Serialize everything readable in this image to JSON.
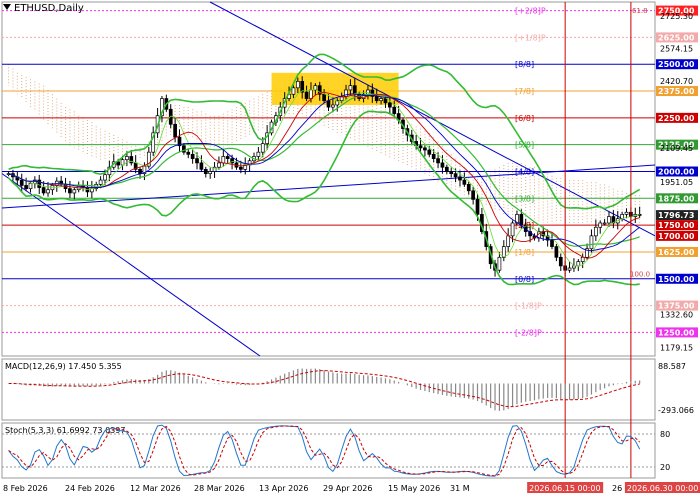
{
  "chart_data": {
    "type": "candlestick",
    "symbol_title": "ETHUSD,Daily",
    "price_axis_ticks": [
      "2725.30",
      "2574.15",
      "2420.70",
      "2109.45",
      "1951.05",
      "1332.60",
      "1179.15"
    ],
    "murrey_levels": [
      {
        "price": 2750.0,
        "label": "[+2/8]P",
        "color": "#ee33ee",
        "box": "2750.00",
        "box_color": "#ff2222"
      },
      {
        "price": 2625.0,
        "label": "[+1/8]P",
        "color": "#f2aaaa",
        "box": "2625.00",
        "box_color": "#f2aaaa"
      },
      {
        "price": 2500.0,
        "label": "[8/8]",
        "color": "#0000cc",
        "box": "2500.00",
        "box_color": "#0000cc"
      },
      {
        "price": 2375.0,
        "label": "[7/8]",
        "color": "#f0a030",
        "box": "2375.00",
        "box_color": "#f0a030"
      },
      {
        "price": 2250.0,
        "label": "[6/8]",
        "color": "#cc0000",
        "box": "2250.00",
        "box_color": "#cc0000"
      },
      {
        "price": 2125.0,
        "label": "[5/8]",
        "color": "#33aa33",
        "box": "2125.00",
        "box_color": "#339933"
      },
      {
        "price": 2000.0,
        "label": "[4/8]",
        "color": "#0000cc",
        "box": "2000.00",
        "box_color": "#0000cc"
      },
      {
        "price": 1875.0,
        "label": "[3/8]",
        "color": "#33aa33",
        "box": "1875.00",
        "box_color": "#339933"
      },
      {
        "price": 1750.0,
        "label": "[2/8]",
        "color": "#cc0000",
        "box": "1750.00",
        "box_color": "#cc0000"
      },
      {
        "price": 1625.0,
        "label": "[1/8]",
        "color": "#f0a030",
        "box": "1625.00",
        "box_color": "#f0a030"
      },
      {
        "price": 1500.0,
        "label": "[0/8]",
        "color": "#0000cc",
        "box": "1500.00",
        "box_color": "#0000cc"
      },
      {
        "price": 1375.0,
        "label": "[-1/8]P",
        "color": "#f2aaaa",
        "box": "1375.00",
        "box_color": "#f2aaaa"
      },
      {
        "price": 1250.0,
        "label": "[-2/8]P",
        "color": "#ee33ee",
        "box": "1250.00",
        "box_color": "#ee33ee"
      }
    ],
    "extra_price_labels": [
      {
        "price": 1796.73,
        "box": "1796.73",
        "box_color": "#222222"
      },
      {
        "price": 1700.0,
        "box": "1700.00",
        "box_color": "#cc0000"
      }
    ],
    "fibo_labels": [
      "61.8",
      "100.0"
    ],
    "x_ticks": [
      "8 Feb 2026",
      "24 Feb 2026",
      "12 Mar 2026",
      "28 Mar 2026",
      "13 Apr 2026",
      "29 Apr 2026",
      "15 May 2026",
      "31 M"
    ],
    "vline_labels": [
      "2026.06.15 00:00",
      "2026.06.30 00:00"
    ],
    "x_tick_tail": "26",
    "price_range": [
      1140,
      2790
    ],
    "days": 145,
    "start_date": "2026-02-08",
    "vlines_dates": [
      "2026-06-15",
      "2026-06-30"
    ],
    "closes": [
      1990,
      1975,
      1960,
      1935,
      1920,
      1945,
      1960,
      1925,
      1900,
      1915,
      1935,
      1955,
      1940,
      1920,
      1900,
      1915,
      1935,
      1925,
      1905,
      1920,
      1940,
      1960,
      1985,
      2020,
      2045,
      2030,
      2055,
      2070,
      2040,
      2010,
      1990,
      2025,
      2090,
      2180,
      2260,
      2340,
      2290,
      2220,
      2160,
      2120,
      2090,
      2080,
      2060,
      2040,
      2010,
      1990,
      2000,
      2020,
      2040,
      2070,
      2060,
      2040,
      2020,
      2010,
      2030,
      2050,
      2070,
      2090,
      2130,
      2180,
      2230,
      2260,
      2300,
      2340,
      2360,
      2390,
      2420,
      2370,
      2340,
      2380,
      2400,
      2360,
      2330,
      2300,
      2310,
      2330,
      2350,
      2380,
      2400,
      2360,
      2340,
      2360,
      2380,
      2350,
      2330,
      2340,
      2320,
      2300,
      2270,
      2240,
      2200,
      2170,
      2140,
      2120,
      2110,
      2100,
      2080,
      2060,
      2040,
      2020,
      2000,
      1990,
      1975,
      1960,
      1940,
      1910,
      1870,
      1800,
      1720,
      1650,
      1570,
      1540,
      1600,
      1650,
      1700,
      1760,
      1800,
      1750,
      1720,
      1700,
      1690,
      1720,
      1700,
      1680,
      1650,
      1600,
      1560,
      1540,
      1550,
      1560,
      1580,
      1600,
      1640,
      1700,
      1740,
      1760,
      1760,
      1790,
      1760,
      1780,
      1800,
      1810,
      1790,
      1800,
      1796
    ],
    "cloud_top": [
      2500,
      2480,
      2460,
      2450,
      2440,
      2430,
      2420,
      2410,
      2400,
      2380,
      2360,
      2340,
      2320,
      2300,
      2290,
      2280,
      2260,
      2250,
      2240,
      2230,
      2210,
      2200,
      2190,
      2180,
      2170,
      2160,
      2150,
      2140,
      2130,
      2120,
      2110,
      2120,
      2140,
      2180,
      2220,
      2260,
      2280,
      2300,
      2310,
      2310,
      2300,
      2300,
      2290,
      2280,
      2280,
      2270,
      2260,
      2260,
      2260,
      2270,
      2280,
      2290,
      2300,
      2310,
      2320,
      2330,
      2340,
      2350,
      2360,
      2370,
      2380,
      2390,
      2400,
      2420,
      2440,
      2440,
      2450,
      2440,
      2430,
      2420,
      2410,
      2400,
      2400,
      2390,
      2380,
      2380,
      2380,
      2370,
      2370,
      2360,
      2350,
      2340,
      2330,
      2320,
      2310,
      2300,
      2290,
      2280,
      2260,
      2250,
      2240,
      2230,
      2220,
      2210,
      2200,
      2190,
      2180,
      2160,
      2140,
      2120,
      2100,
      2080,
      2060,
      2040,
      2020,
      2000,
      1990,
      1980,
      1980,
      1990,
      2000,
      2010,
      2020,
      2030,
      2040,
      2040,
      2040,
      2040,
      2030,
      2020,
      2020,
      2010,
      2000,
      1990,
      1980,
      1970,
      1970,
      1960,
      1960,
      1960,
      1960,
      1960,
      1950,
      1950,
      1950,
      1940,
      1940,
      1930,
      1920,
      1910,
      1910,
      1900,
      1900,
      1890,
      1890
    ],
    "cloud_bottom": [
      2400,
      2380,
      2360,
      2340,
      2320,
      2300,
      2280,
      2260,
      2240,
      2220,
      2200,
      2180,
      2160,
      2140,
      2120,
      2110,
      2100,
      2090,
      2080,
      2070,
      2060,
      2050,
      2050,
      2040,
      2040,
      2030,
      2030,
      2030,
      2040,
      2050,
      2060,
      2070,
      2080,
      2100,
      2120,
      2140,
      2160,
      2170,
      2180,
      2180,
      2170,
      2160,
      2150,
      2140,
      2130,
      2120,
      2110,
      2100,
      2100,
      2110,
      2120,
      2130,
      2140,
      2150,
      2160,
      2170,
      2180,
      2190,
      2200,
      2210,
      2220,
      2230,
      2240,
      2250,
      2260,
      2260,
      2270,
      2260,
      2250,
      2240,
      2230,
      2220,
      2210,
      2200,
      2190,
      2180,
      2170,
      2160,
      2150,
      2140,
      2130,
      2120,
      2110,
      2100,
      2090,
      2080,
      2070,
      2060,
      2050,
      2040,
      2030,
      2020,
      2010,
      2000,
      1990,
      1980,
      1970,
      1960,
      1950,
      1940,
      1930,
      1920,
      1910,
      1900,
      1890,
      1880,
      1870,
      1860,
      1850,
      1840,
      1830,
      1820,
      1810,
      1800,
      1790,
      1780,
      1770,
      1760,
      1760,
      1760,
      1760,
      1760,
      1760,
      1760,
      1760,
      1760,
      1760,
      1760,
      1760,
      1760,
      1760,
      1760,
      1760,
      1760,
      1760,
      1760,
      1760,
      1760,
      1760,
      1760,
      1760,
      1760,
      1760,
      1760,
      1760
    ],
    "macd": {
      "label": "MACD(12,26,9) 17.450 5.355",
      "axis_ticks": [
        "88.587",
        "-293.066"
      ]
    },
    "stoch": {
      "label": "Stoch(5,3,3) 61.6992 73.0397",
      "axis_ticks": [
        "80",
        "20"
      ]
    },
    "colors": {
      "bull_candle": "#000000",
      "bear_candle": "#000000",
      "cloud": "#d99a6a",
      "bollinger": "#33bb33",
      "ma_red": "#cc0000",
      "ma_blue": "#0000cc",
      "box_highlight": "#ffcc00"
    }
  }
}
